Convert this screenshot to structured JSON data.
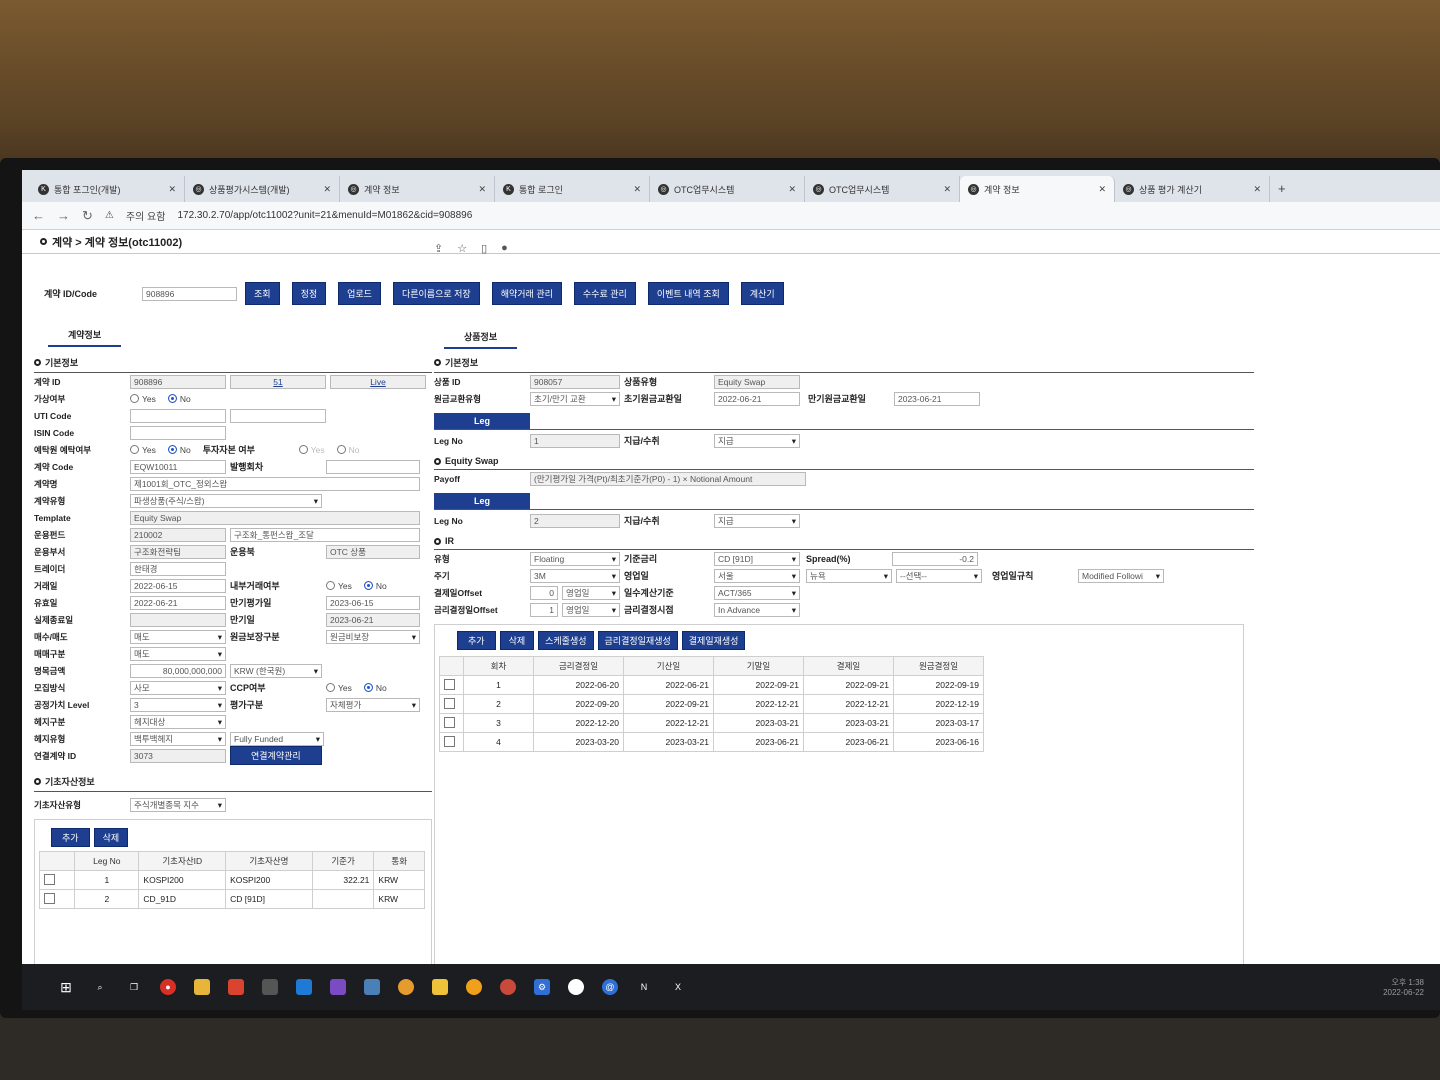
{
  "browser": {
    "tabs": [
      "통합 포그인(개발)",
      "상품평가시스템(개발)",
      "계약 정보",
      "통합 로그인",
      "OTC업무시스템",
      "OTC업무시스템",
      "계약 정보",
      "상품 평가 계산기"
    ],
    "security": "주의 요함",
    "url": "172.30.2.70/app/otc11002?unit=21&menuId=M01862&cid=908896"
  },
  "breadcrumb": "계약 > 계약 정보(otc11002)",
  "toolbar": {
    "id_label": "계약 ID/Code",
    "id_value": "908896",
    "buttons": [
      "조회",
      "정정",
      "업로드",
      "다른이름으로 저장",
      "해약거래 관리",
      "수수료 관리",
      "이벤트 내역 조회",
      "계산기"
    ]
  },
  "left": {
    "tab": "계약정보",
    "section": "기본정보",
    "contract_id": {
      "label": "계약 ID",
      "value": "908896",
      "extra1": "51",
      "extra2": "Live"
    },
    "temp": {
      "label": "가상여부",
      "yes": "Yes",
      "no": "No"
    },
    "uti": {
      "label": "UTI Code"
    },
    "isin": {
      "label": "ISIN Code"
    },
    "deposit": {
      "label": "예탁원 예탁여부",
      "yes": "Yes",
      "no": "No",
      "label2": "투자자본 여부",
      "yes2": "Yes",
      "no2": "No"
    },
    "code": {
      "label": "계약 Code",
      "value": "EQW10011",
      "label2": "발행회차"
    },
    "name": {
      "label": "계약명",
      "value": "제1001회_OTC_정외스왑"
    },
    "type": {
      "label": "계약유형",
      "value": "파생상품(주식/스왑)"
    },
    "template": {
      "label": "Template",
      "value": "Equity Swap"
    },
    "fund": {
      "label": "운용펀드",
      "value": "210002",
      "value2": "구조화_통펀스왑_조달"
    },
    "dept": {
      "label": "운용부서",
      "value": "구조화전략팀",
      "label2": "운용북",
      "value2": "OTC 상품"
    },
    "trader": {
      "label": "트레이더",
      "value": "한태경"
    },
    "trade_date": {
      "label": "거래일",
      "value": "2022-06-15",
      "label2": "내부거래여부",
      "yes": "Yes",
      "no": "No"
    },
    "eff_date": {
      "label": "유효일",
      "value": "2022-06-21",
      "label2": "만기평가일",
      "value2": "2023-06-15"
    },
    "settle": {
      "label": "실제종료일",
      "label2": "만기일",
      "value2": "2023-06-21"
    },
    "buysell": {
      "label": "매수/매도",
      "value": "매도",
      "label2": "원금보장구분",
      "value2": "원금비보장"
    },
    "trade_div": {
      "label": "매매구분",
      "value": "매도"
    },
    "notional": {
      "label": "명목금액",
      "value": "80,000,000,000",
      "ccy": "KRW (한국원)"
    },
    "offer": {
      "label": "모집방식",
      "value": "사모",
      "label2": "CCP여부",
      "yes": "Yes",
      "no": "No"
    },
    "fv": {
      "label": "공정가치 Level",
      "value": "3",
      "label2": "평가구분",
      "value2": "자체평가"
    },
    "hedge": {
      "label": "헤지구분",
      "value": "헤지대상"
    },
    "hedge_type": {
      "label": "헤지유형",
      "value": "백투백헤지",
      "value2": "Fully Funded"
    },
    "link": {
      "label": "연결계약 ID",
      "value": "3073",
      "btn": "연결계약관리"
    },
    "under_section": "기초자산정보",
    "under_type": {
      "label": "기초자산유형",
      "value": "주식개별종목 지수"
    },
    "under_buttons": [
      "추가",
      "삭제"
    ],
    "under_cols": [
      "Leg No",
      "기초자산ID",
      "기초자산명",
      "기준가",
      "통화"
    ],
    "under_rows": [
      [
        "1",
        "KOSPI200",
        "KOSPI200",
        "322.21",
        "KRW"
      ],
      [
        "2",
        "CD_91D",
        "CD [91D]",
        "",
        "KRW"
      ]
    ]
  },
  "right": {
    "tab": "상품정보",
    "section": "기본정보",
    "prod_id": {
      "label": "상품 ID",
      "value": "908057",
      "label2": "상품유형",
      "value2": "Equity Swap"
    },
    "principal": {
      "label": "원금교환유형",
      "value": "초기/만기 교환",
      "label2": "초기원금교환일",
      "value2": "2022-06-21",
      "label3": "만기원금교환일",
      "value3": "2023-06-21"
    },
    "leg_label": "Leg",
    "leg1": {
      "label": "Leg No",
      "value": "1",
      "label2": "지급/수취",
      "value2": "지급"
    },
    "eq_section": "Equity Swap",
    "payoff": {
      "label": "Payoff",
      "value": "(만기평가일 가격(Pt)/최초기준가(P0) - 1) × Notional Amount"
    },
    "leg2": {
      "label": "Leg No",
      "value": "2",
      "label2": "지급/수취",
      "value2": "지급"
    },
    "ir_section": "IR",
    "ir": {
      "type": {
        "label": "유형",
        "value": "Floating",
        "label2": "기준금리",
        "value2": "CD [91D]",
        "label3": "Spread(%)",
        "value3": "-0.2"
      },
      "period": {
        "label": "주기",
        "value": "3M",
        "label2": "영업일",
        "value2": "서울",
        "value3": "뉴욕",
        "value4": "--선택--",
        "label5": "영업일규칙",
        "value5": "Modified Followi"
      },
      "pay_off": {
        "label": "결제일Offset",
        "value": "0",
        "unit": "영업일",
        "label2": "일수계산기준",
        "value2": "ACT/365"
      },
      "fix_off": {
        "label": "금리결정일Offset",
        "value": "1",
        "unit": "영업일",
        "label2": "금리결정시점",
        "value2": "In Advance"
      }
    },
    "ir_buttons": [
      "추가",
      "삭제",
      "스케줄생성",
      "금리결정일재생성",
      "결제일재생성"
    ],
    "sched_cols": [
      "회차",
      "금리결정일",
      "기산일",
      "기말일",
      "결제일",
      "원금결정일"
    ],
    "sched_rows": [
      [
        "1",
        "2022-06-20",
        "2022-06-21",
        "2022-09-21",
        "2022-09-21",
        "2022-09-19"
      ],
      [
        "2",
        "2022-09-20",
        "2022-09-21",
        "2022-12-21",
        "2022-12-21",
        "2022-12-19"
      ],
      [
        "3",
        "2022-12-20",
        "2022-12-21",
        "2023-03-21",
        "2023-03-21",
        "2023-03-17"
      ],
      [
        "4",
        "2023-03-20",
        "2023-03-21",
        "2023-06-21",
        "2023-06-21",
        "2023-06-16"
      ]
    ]
  },
  "tray": {
    "time": "오후 1:38",
    "date": "2022-06-22"
  }
}
